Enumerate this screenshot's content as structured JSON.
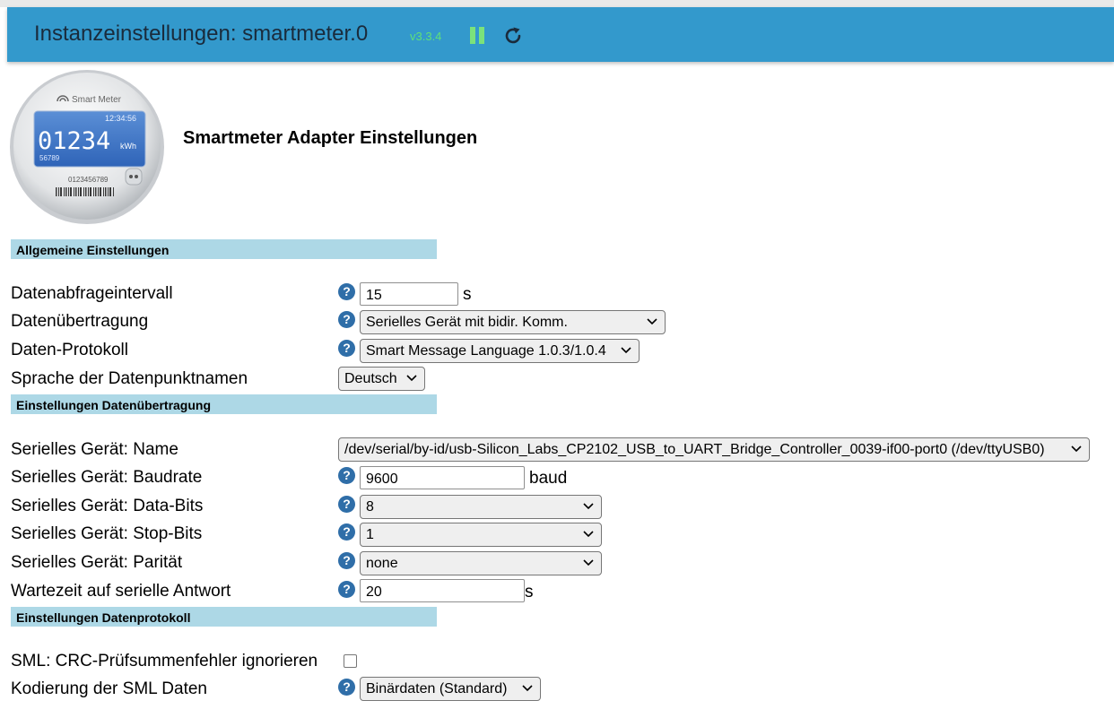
{
  "header": {
    "title": "Instanzeinstellungen: smartmeter.0",
    "version": "v3.3.4"
  },
  "logo": {
    "brand": "Smart Meter",
    "time": "12:34:56",
    "reading": "01234",
    "unit": "kWh",
    "sub": "56789",
    "serial": "0123456789"
  },
  "page_title": "Smartmeter Adapter Einstellungen",
  "sections": {
    "general": "Allgemeine Einstellungen",
    "transfer": "Einstellungen Datenübertragung",
    "protocol": "Einstellungen Datenprotokoll"
  },
  "fields": {
    "interval": {
      "label": "Datenabfrageintervall",
      "value": "15",
      "unit": "s"
    },
    "transfer": {
      "label": "Datenübertragung",
      "value": "Serielles Gerät mit bidir. Komm."
    },
    "protocol": {
      "label": "Daten-Protokoll",
      "value": "Smart Message Language 1.0.3/1.0.4"
    },
    "language": {
      "label": "Sprache der Datenpunktnamen",
      "value": "Deutsch"
    },
    "serial_name": {
      "label": "Serielles Gerät: Name",
      "value": "/dev/serial/by-id/usb-Silicon_Labs_CP2102_USB_to_UART_Bridge_Controller_0039-if00-port0 (/dev/ttyUSB0)"
    },
    "baudrate": {
      "label": "Serielles Gerät: Baudrate",
      "value": "9600",
      "unit": "baud"
    },
    "databits": {
      "label": "Serielles Gerät: Data-Bits",
      "value": "8"
    },
    "stopbits": {
      "label": "Serielles Gerät: Stop-Bits",
      "value": "1"
    },
    "parity": {
      "label": "Serielles Gerät: Parität",
      "value": "none"
    },
    "timeout": {
      "label": "Wartezeit auf serielle Antwort",
      "value": "20",
      "unit": "s"
    },
    "crc": {
      "label": "SML: CRC-Prüfsummenfehler ignorieren",
      "checked": false
    },
    "encoding": {
      "label": "Kodierung der SML Daten",
      "value": "Binärdaten (Standard)"
    }
  },
  "help_glyph": "?",
  "icons": {
    "pause": "pause-icon",
    "reload": "reload-icon",
    "help": "help-icon",
    "chevron": "chevron-down-icon"
  },
  "colors": {
    "header": "#3399cc",
    "section": "#add8e6",
    "version": "#5fe07a",
    "help": "#2f6ea8"
  }
}
